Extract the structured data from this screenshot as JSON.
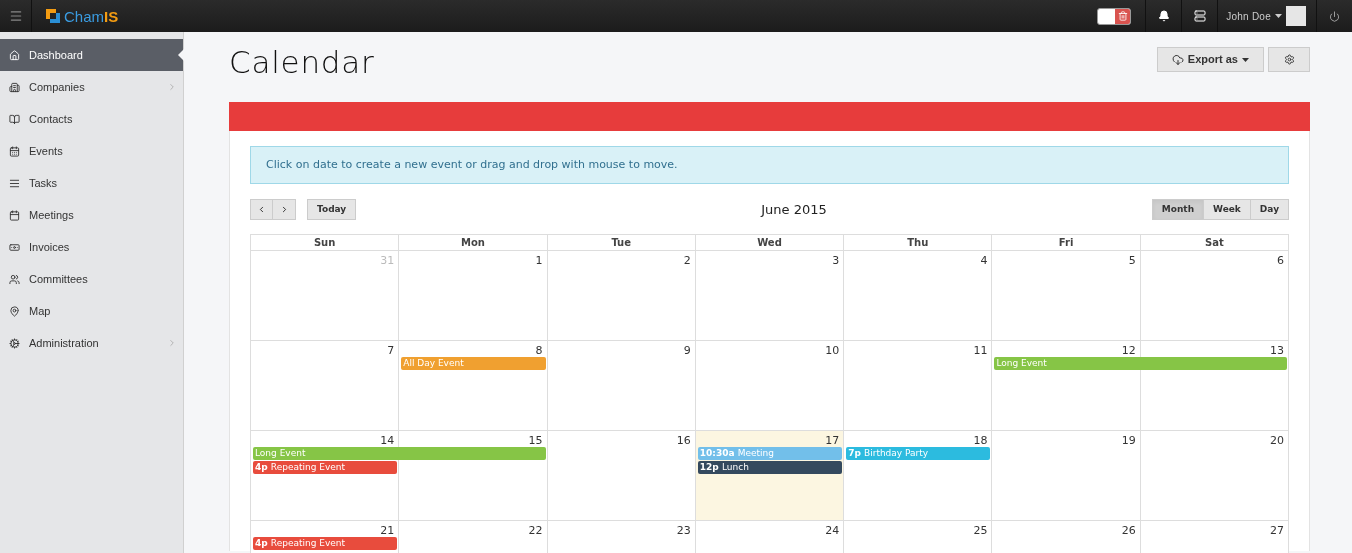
{
  "topbar": {
    "logo": {
      "start": "Cham",
      "end": "IS"
    },
    "trash_toggle": {
      "on": true
    },
    "user": "John Doe"
  },
  "sidebar": {
    "items": [
      {
        "label": "Dashboard",
        "selected": true,
        "submenu": false
      },
      {
        "label": "Companies",
        "selected": false,
        "submenu": true
      },
      {
        "label": "Contacts",
        "selected": false,
        "submenu": false
      },
      {
        "label": "Events",
        "selected": false,
        "submenu": false
      },
      {
        "label": "Tasks",
        "selected": false,
        "submenu": false
      },
      {
        "label": "Meetings",
        "selected": false,
        "submenu": false
      },
      {
        "label": "Invoices",
        "selected": false,
        "submenu": false
      },
      {
        "label": "Committees",
        "selected": false,
        "submenu": false
      },
      {
        "label": "Map",
        "selected": false,
        "submenu": false
      },
      {
        "label": "Administration",
        "selected": false,
        "submenu": true
      }
    ]
  },
  "page": {
    "title": "Calendar",
    "export_button": "Export as"
  },
  "calendar": {
    "notice": "Click on date to create a new event or drag and drop with mouse to move.",
    "month": "June 2015",
    "today_button": "Today",
    "views": [
      {
        "label": "Month",
        "selected": true
      },
      {
        "label": "Week",
        "selected": false
      },
      {
        "label": "Day",
        "selected": false
      }
    ],
    "weekdays": [
      "Sun",
      "Mon",
      "Tue",
      "Wed",
      "Thu",
      "Fri",
      "Sat"
    ],
    "weeks": [
      {
        "days": [
          {
            "date": "31",
            "other_month": true,
            "today": false
          },
          {
            "date": "1",
            "other_month": false,
            "today": false
          },
          {
            "date": "2",
            "other_month": false,
            "today": false
          },
          {
            "date": "3",
            "other_month": false,
            "today": false
          },
          {
            "date": "4",
            "other_month": false,
            "today": false
          },
          {
            "date": "5",
            "other_month": false,
            "today": false
          },
          {
            "date": "6",
            "other_month": false,
            "today": false
          }
        ]
      },
      {
        "days": [
          {
            "date": "7",
            "other_month": false,
            "today": false
          },
          {
            "date": "8",
            "other_month": false,
            "today": false,
            "events": [
              {
                "title": "All Day Event",
                "color": "#f0a030",
                "spans_next_day": false
              }
            ]
          },
          {
            "date": "9",
            "other_month": false,
            "today": false
          },
          {
            "date": "10",
            "other_month": false,
            "today": false
          },
          {
            "date": "11",
            "other_month": false,
            "today": false
          },
          {
            "date": "12",
            "other_month": false,
            "today": false,
            "events": [
              {
                "title": "Long Event",
                "color": "#86c546",
                "spans_next_day": true
              }
            ]
          },
          {
            "date": "13",
            "other_month": false,
            "today": false
          }
        ]
      },
      {
        "days": [
          {
            "date": "14",
            "other_month": false,
            "today": false,
            "events": [
              {
                "title": "Long Event",
                "color": "#86c546",
                "spans_next_day": true
              },
              {
                "time": "4p",
                "title": "Repeating Event",
                "color": "#e84c3d",
                "spans_next_day": false
              }
            ]
          },
          {
            "date": "15",
            "other_month": false,
            "today": false
          },
          {
            "date": "16",
            "other_month": false,
            "today": false
          },
          {
            "date": "17",
            "other_month": false,
            "today": true,
            "events": [
              {
                "time": "10:30a",
                "title": "Meeting",
                "color": "#72bfea",
                "spans_next_day": false
              },
              {
                "time": "12p",
                "title": "Lunch",
                "color": "#34495e",
                "spans_next_day": false
              }
            ]
          },
          {
            "date": "18",
            "other_month": false,
            "today": false,
            "events": [
              {
                "time": "7p",
                "title": "Birthday Party",
                "color": "#2cbbdf",
                "spans_next_day": false
              }
            ]
          },
          {
            "date": "19",
            "other_month": false,
            "today": false
          },
          {
            "date": "20",
            "other_month": false,
            "today": false
          }
        ]
      },
      {
        "days": [
          {
            "date": "21",
            "other_month": false,
            "today": false,
            "events": [
              {
                "time": "4p",
                "title": "Repeating Event",
                "color": "#e84c3d",
                "spans_next_day": false
              }
            ]
          },
          {
            "date": "22",
            "other_month": false,
            "today": false
          },
          {
            "date": "23",
            "other_month": false,
            "today": false
          },
          {
            "date": "24",
            "other_month": false,
            "today": false
          },
          {
            "date": "25",
            "other_month": false,
            "today": false
          },
          {
            "date": "26",
            "other_month": false,
            "today": false
          },
          {
            "date": "27",
            "other_month": false,
            "today": false
          }
        ]
      }
    ]
  }
}
